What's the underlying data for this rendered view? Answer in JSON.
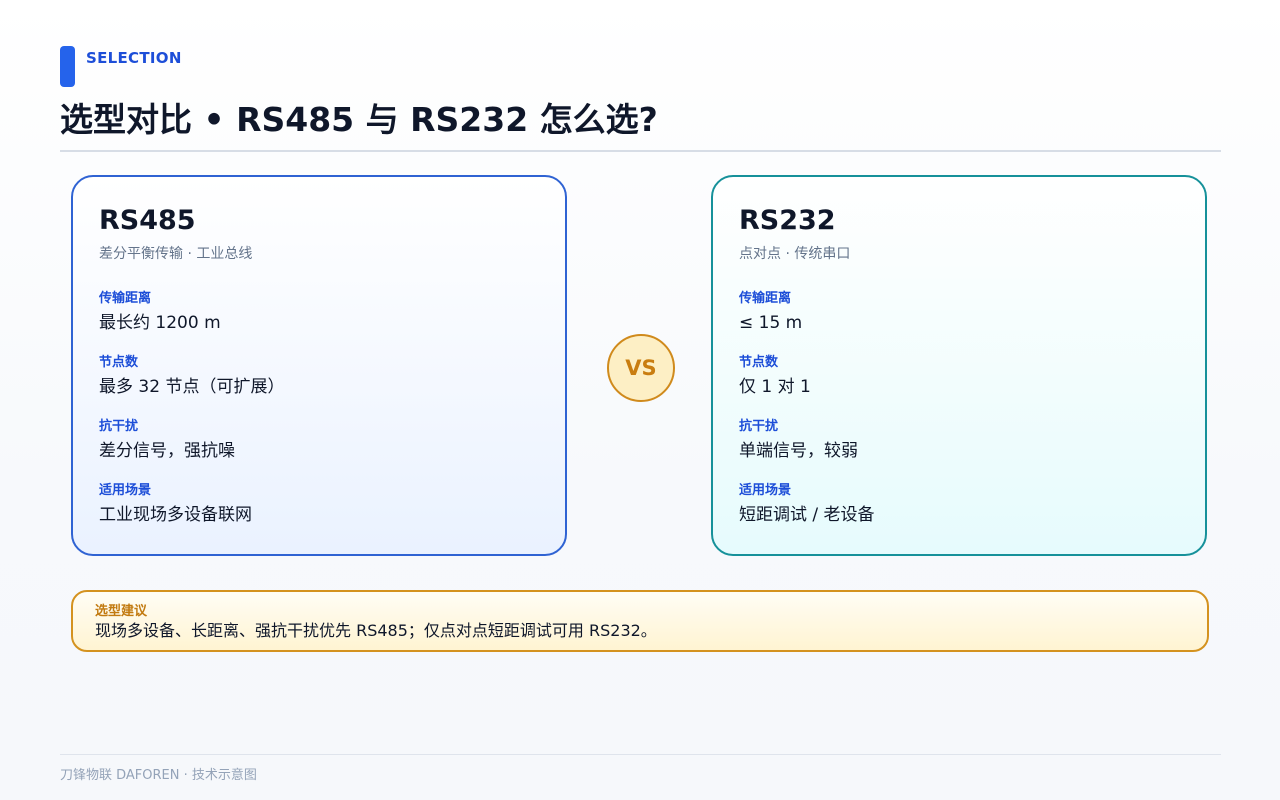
{
  "header": {
    "eyebrow": "SELECTION",
    "title": "选型对比 • RS485 与 RS232 怎么选?"
  },
  "cards": [
    {
      "title": "RS485",
      "subtitle": "差分平衡传输 · 工业总线",
      "fields": [
        {
          "label": "传输距离",
          "value": "最长约 1200 m"
        },
        {
          "label": "节点数",
          "value": "最多 32 节点（可扩展）"
        },
        {
          "label": "抗干扰",
          "value": "差分信号，强抗噪"
        },
        {
          "label": "适用场景",
          "value": "工业现场多设备联网"
        }
      ]
    },
    {
      "title": "RS232",
      "subtitle": "点对点 · 传统串口",
      "fields": [
        {
          "label": "传输距离",
          "value": "≤ 15 m"
        },
        {
          "label": "节点数",
          "value": "仅 1 对 1"
        },
        {
          "label": "抗干扰",
          "value": "单端信号，较弱"
        },
        {
          "label": "适用场景",
          "value": "短距调试 / 老设备"
        }
      ]
    }
  ],
  "vs_label": "VS",
  "advice": {
    "label": "选型建议",
    "text": "现场多设备、长距离、强抗干扰优先 RS485；仅点对点短距调试可用 RS232。"
  },
  "footer": {
    "text": "刀锋物联 DAFOREN · 技术示意图"
  },
  "colors": {
    "accent_blue": "#2563eb",
    "card_left_border": "#2f63d3",
    "card_right_border": "#16919a",
    "vs_orange": "#d08a1c",
    "advice_border": "#d4921f"
  }
}
